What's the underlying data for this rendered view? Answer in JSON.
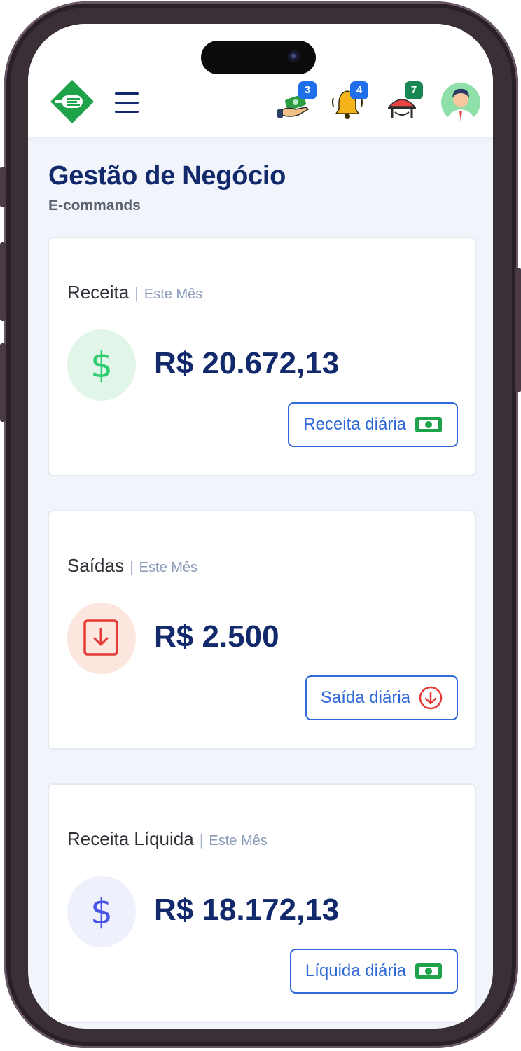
{
  "header": {
    "icons": [
      {
        "name": "money-hand-icon",
        "badge": "3",
        "badge_color": "#1f6feb"
      },
      {
        "name": "bell-icon",
        "badge": "4",
        "badge_color": "#1f6feb"
      },
      {
        "name": "waiter-cloche-icon",
        "badge": "7",
        "badge_color": "#198754"
      }
    ]
  },
  "page": {
    "title": "Gestão de Negócio",
    "subtitle": "E-commands"
  },
  "cards": [
    {
      "title": "Receita",
      "period": "Este Mês",
      "value": "R$ 20.672,13",
      "button": "Receita diária",
      "icon": "dollar-icon",
      "accent": "#2ecc71"
    },
    {
      "title": "Saídas",
      "period": "Este Mês",
      "value": "R$ 2.500",
      "button": "Saída diária",
      "icon": "arrow-down-box-icon",
      "accent": "#e53935"
    },
    {
      "title": "Receita Líquida",
      "period": "Este Mês",
      "value": "R$ 18.172,13",
      "button": "Líquida diária",
      "icon": "dollar-icon",
      "accent": "#4a55e8"
    }
  ],
  "colors": {
    "primary_text": "#12296b",
    "button_blue": "#2f68d8",
    "brand_green": "#1ea24a"
  }
}
